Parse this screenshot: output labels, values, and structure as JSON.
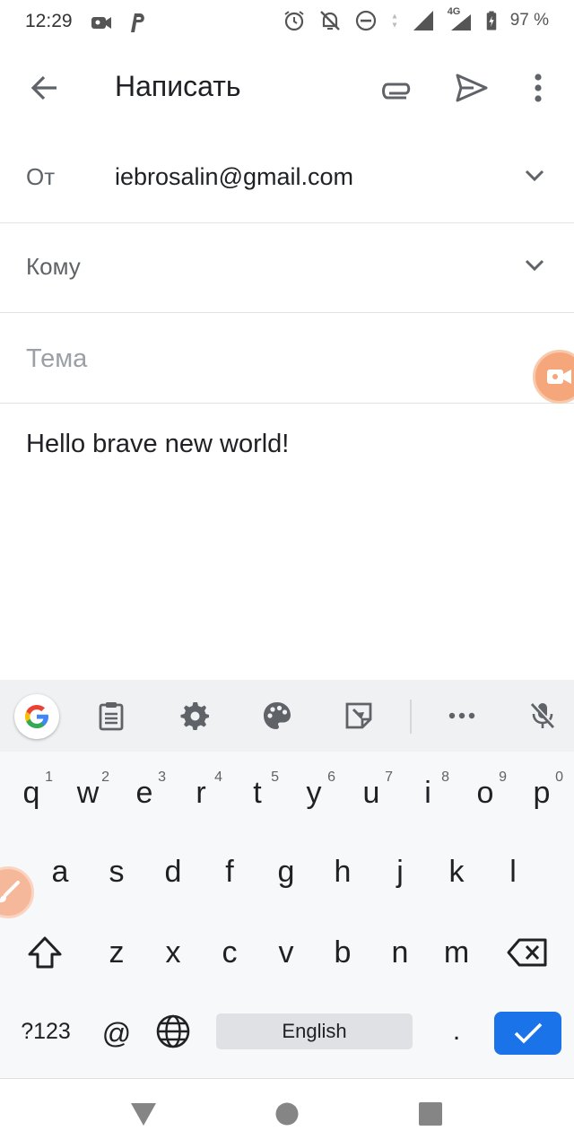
{
  "status_bar": {
    "time": "12:29",
    "battery": "97 %",
    "left_icons": [
      "video-camera-icon",
      "parking-p-icon"
    ],
    "right_icons": [
      "alarm-icon",
      "notifications-off-icon",
      "do-not-disturb-icon",
      "data-arrows-icon",
      "signal-icon",
      "signal-4g-icon",
      "battery-charging-icon"
    ],
    "network_label": "4G"
  },
  "app_bar": {
    "title": "Написать",
    "icons": [
      "back-arrow-icon",
      "paperclip-icon",
      "send-icon",
      "more-vert-icon"
    ]
  },
  "compose": {
    "from_label": "От",
    "from_value": "iebrosalin@gmail.com",
    "to_label": "Кому",
    "subject_placeholder": "Тема",
    "body": "Hello brave new world!"
  },
  "keyboard": {
    "toolbar_icons": [
      "google-g-icon",
      "clipboard-icon",
      "settings-gear-icon",
      "palette-icon",
      "sticker-icon",
      "more-horiz-icon",
      "mic-off-icon"
    ],
    "row1": [
      {
        "k": "q",
        "h": "1"
      },
      {
        "k": "w",
        "h": "2"
      },
      {
        "k": "e",
        "h": "3"
      },
      {
        "k": "r",
        "h": "4"
      },
      {
        "k": "t",
        "h": "5"
      },
      {
        "k": "y",
        "h": "6"
      },
      {
        "k": "u",
        "h": "7"
      },
      {
        "k": "i",
        "h": "8"
      },
      {
        "k": "o",
        "h": "9"
      },
      {
        "k": "p",
        "h": "0"
      }
    ],
    "row2": [
      "a",
      "s",
      "d",
      "f",
      "g",
      "h",
      "j",
      "k",
      "l"
    ],
    "row3": [
      "z",
      "x",
      "c",
      "v",
      "b",
      "n",
      "m"
    ],
    "symbols_key": "?123",
    "at_key": "@",
    "space_label": "English",
    "period_key": ".",
    "accent_color": "#1a73e8"
  },
  "nav_bar": {
    "icons": [
      "back-triangle-icon",
      "home-circle-icon",
      "recents-square-icon"
    ]
  }
}
